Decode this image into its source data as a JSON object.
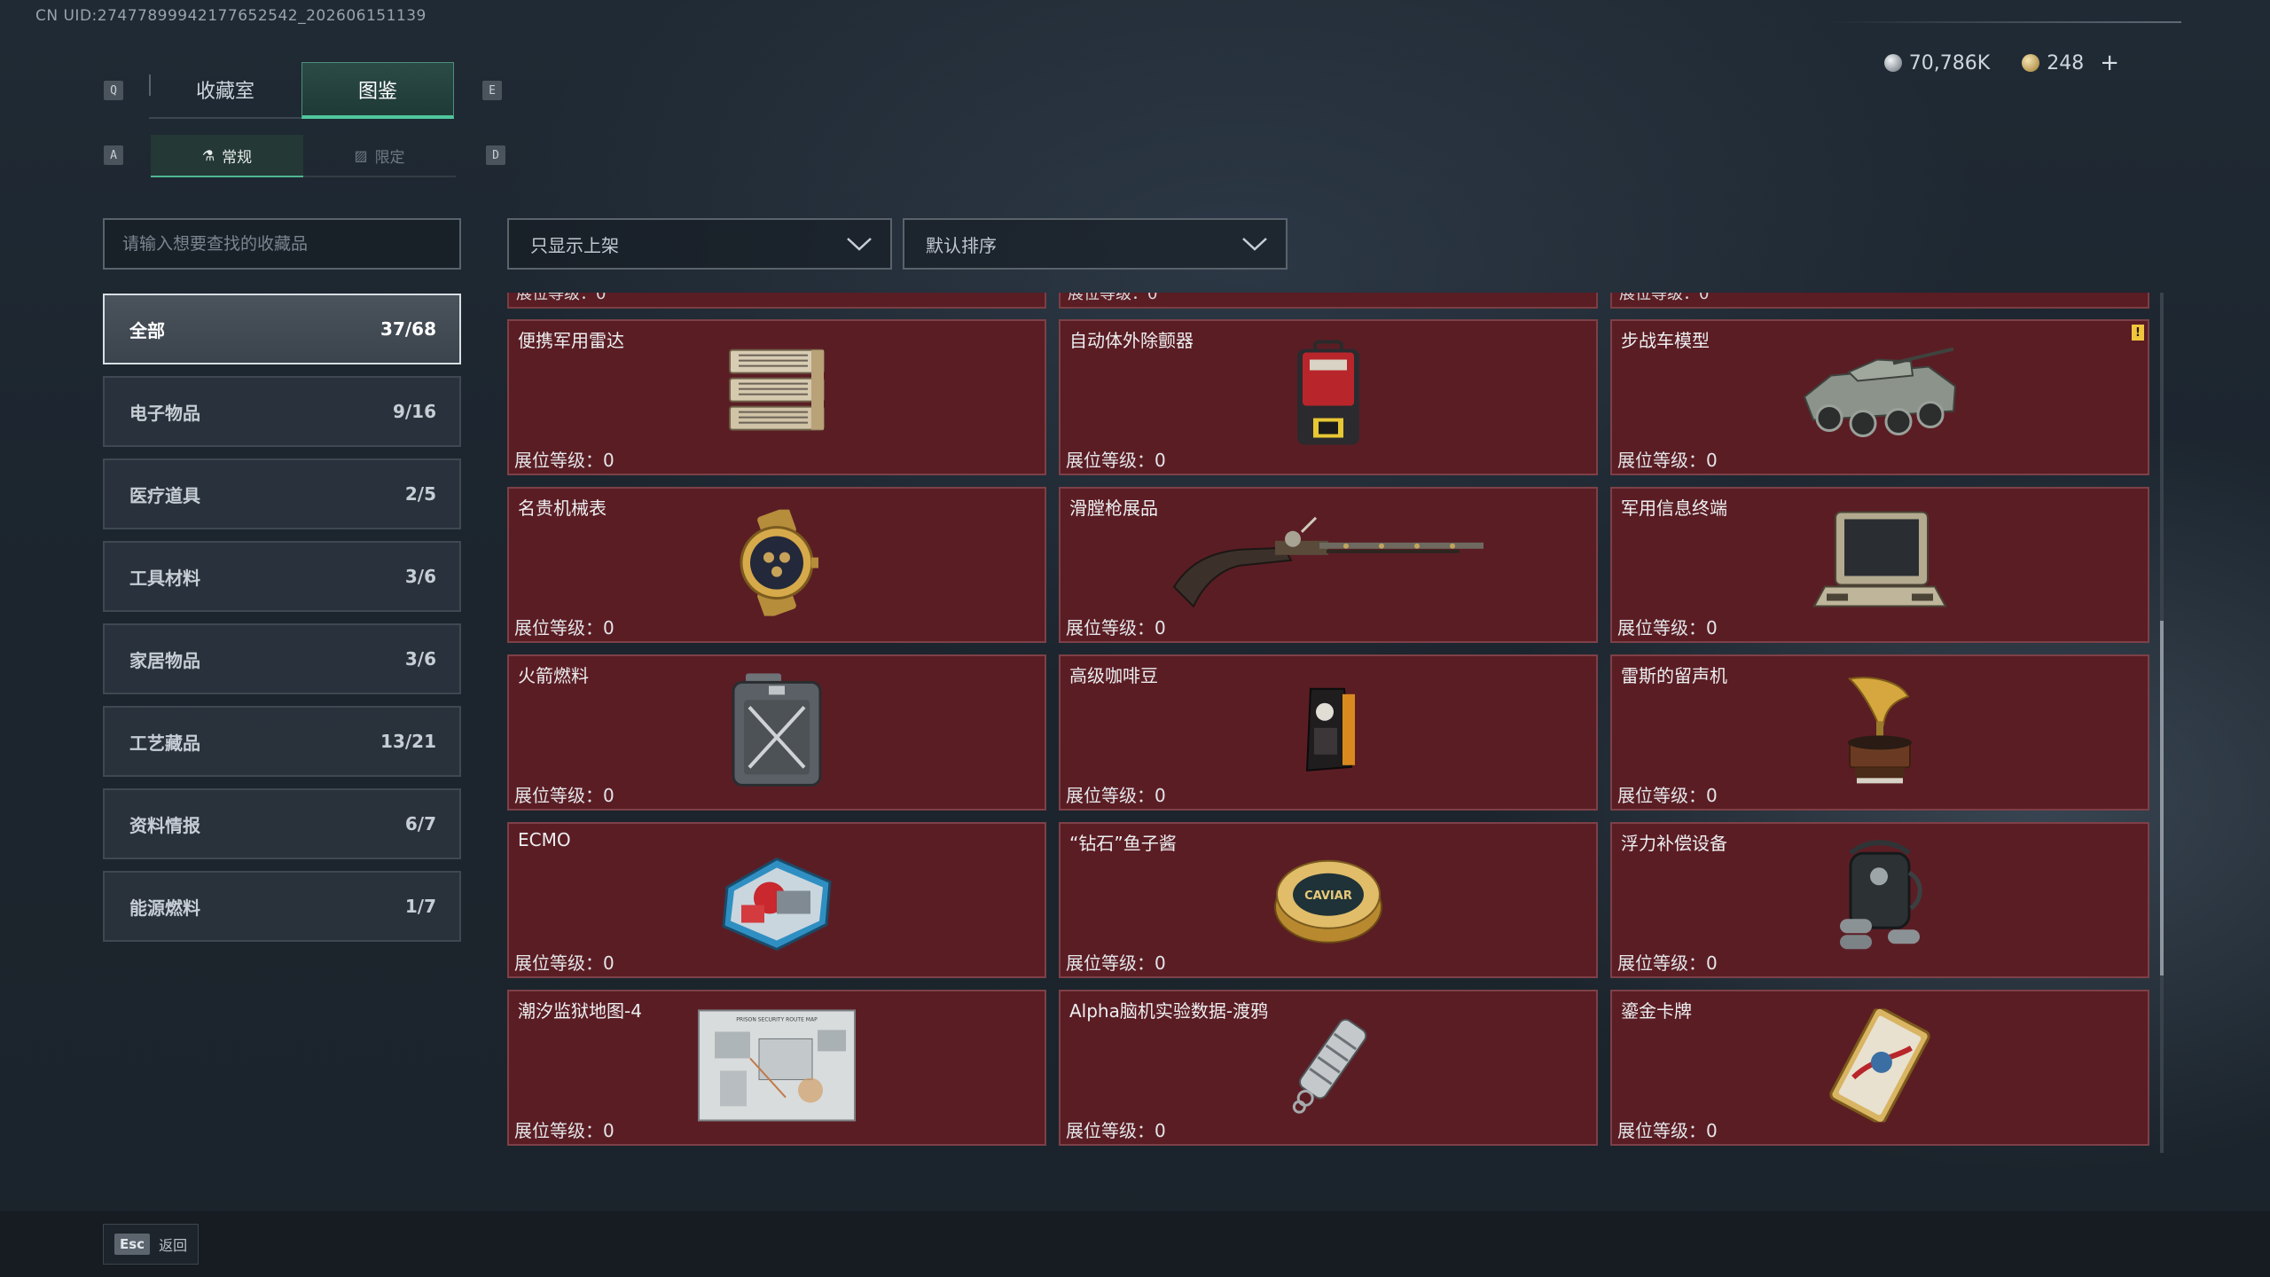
{
  "uid_text": "CN UID:27477899942177652542_202606151139",
  "currency": {
    "silver_value": "70,786K",
    "gold_value": "248",
    "add_label": "+"
  },
  "key_hints": {
    "prev_tab": "Q",
    "next_tab": "E",
    "prev_subtab": "A",
    "next_subtab": "D"
  },
  "tabs": [
    {
      "label": "收藏室"
    },
    {
      "label": "图鉴"
    }
  ],
  "subtabs": [
    {
      "label": "常规"
    },
    {
      "label": "限定"
    }
  ],
  "search": {
    "placeholder": "请输入想要查找的收藏品"
  },
  "categories": [
    {
      "name": "全部",
      "count": "37/68"
    },
    {
      "name": "电子物品",
      "count": "9/16"
    },
    {
      "name": "医疗道具",
      "count": "2/5"
    },
    {
      "name": "工具材料",
      "count": "3/6"
    },
    {
      "name": "家居物品",
      "count": "3/6"
    },
    {
      "name": "工艺藏品",
      "count": "13/21"
    },
    {
      "name": "资料情报",
      "count": "6/7"
    },
    {
      "name": "能源燃料",
      "count": "1/7"
    }
  ],
  "filters": {
    "shelf_filter": "只显示上架",
    "sort": "默认排序"
  },
  "partial_row_label": "展位等级：0",
  "items": [
    {
      "name": "便携军用雷达",
      "level": "展位等级：0",
      "icon": "radar-icon"
    },
    {
      "name": "自动体外除颤器",
      "level": "展位等级：0",
      "icon": "defibrillator-icon"
    },
    {
      "name": "步战车模型",
      "level": "展位等级：0",
      "icon": "ifv-model-icon",
      "badge": "!"
    },
    {
      "name": "名贵机械表",
      "level": "展位等级：0",
      "icon": "watch-icon"
    },
    {
      "name": "滑膛枪展品",
      "level": "展位等级：0",
      "icon": "musket-icon"
    },
    {
      "name": "军用信息终端",
      "level": "展位等级：0",
      "icon": "terminal-icon"
    },
    {
      "name": "火箭燃料",
      "level": "展位等级：0",
      "icon": "fuel-can-icon"
    },
    {
      "name": "高级咖啡豆",
      "level": "展位等级：0",
      "icon": "coffee-bag-icon"
    },
    {
      "name": "雷斯的留声机",
      "level": "展位等级：0",
      "icon": "gramophone-icon"
    },
    {
      "name": "ECMO",
      "level": "展位等级：0",
      "icon": "ecmo-icon"
    },
    {
      "name": "“钻石”鱼子酱",
      "level": "展位等级：0",
      "icon": "caviar-tin-icon",
      "art_text": "CAVIAR"
    },
    {
      "name": "浮力补偿设备",
      "level": "展位等级：0",
      "icon": "bcd-icon"
    },
    {
      "name": "潮汐监狱地图-4",
      "level": "展位等级：0",
      "icon": "map-icon",
      "art_text": "PRISON SECURITY ROUTE MAP"
    },
    {
      "name": "Alpha脑机实验数据-渡鸦",
      "level": "展位等级：0",
      "icon": "data-canister-icon"
    },
    {
      "name": "鎏金卡牌",
      "level": "展位等级：0",
      "icon": "gilded-card-icon"
    }
  ],
  "back": {
    "key": "Esc",
    "label": "返回"
  },
  "colors": {
    "card_bg": "#5b1d24",
    "card_border": "#7e4047",
    "accent_green": "#4fc79c"
  }
}
